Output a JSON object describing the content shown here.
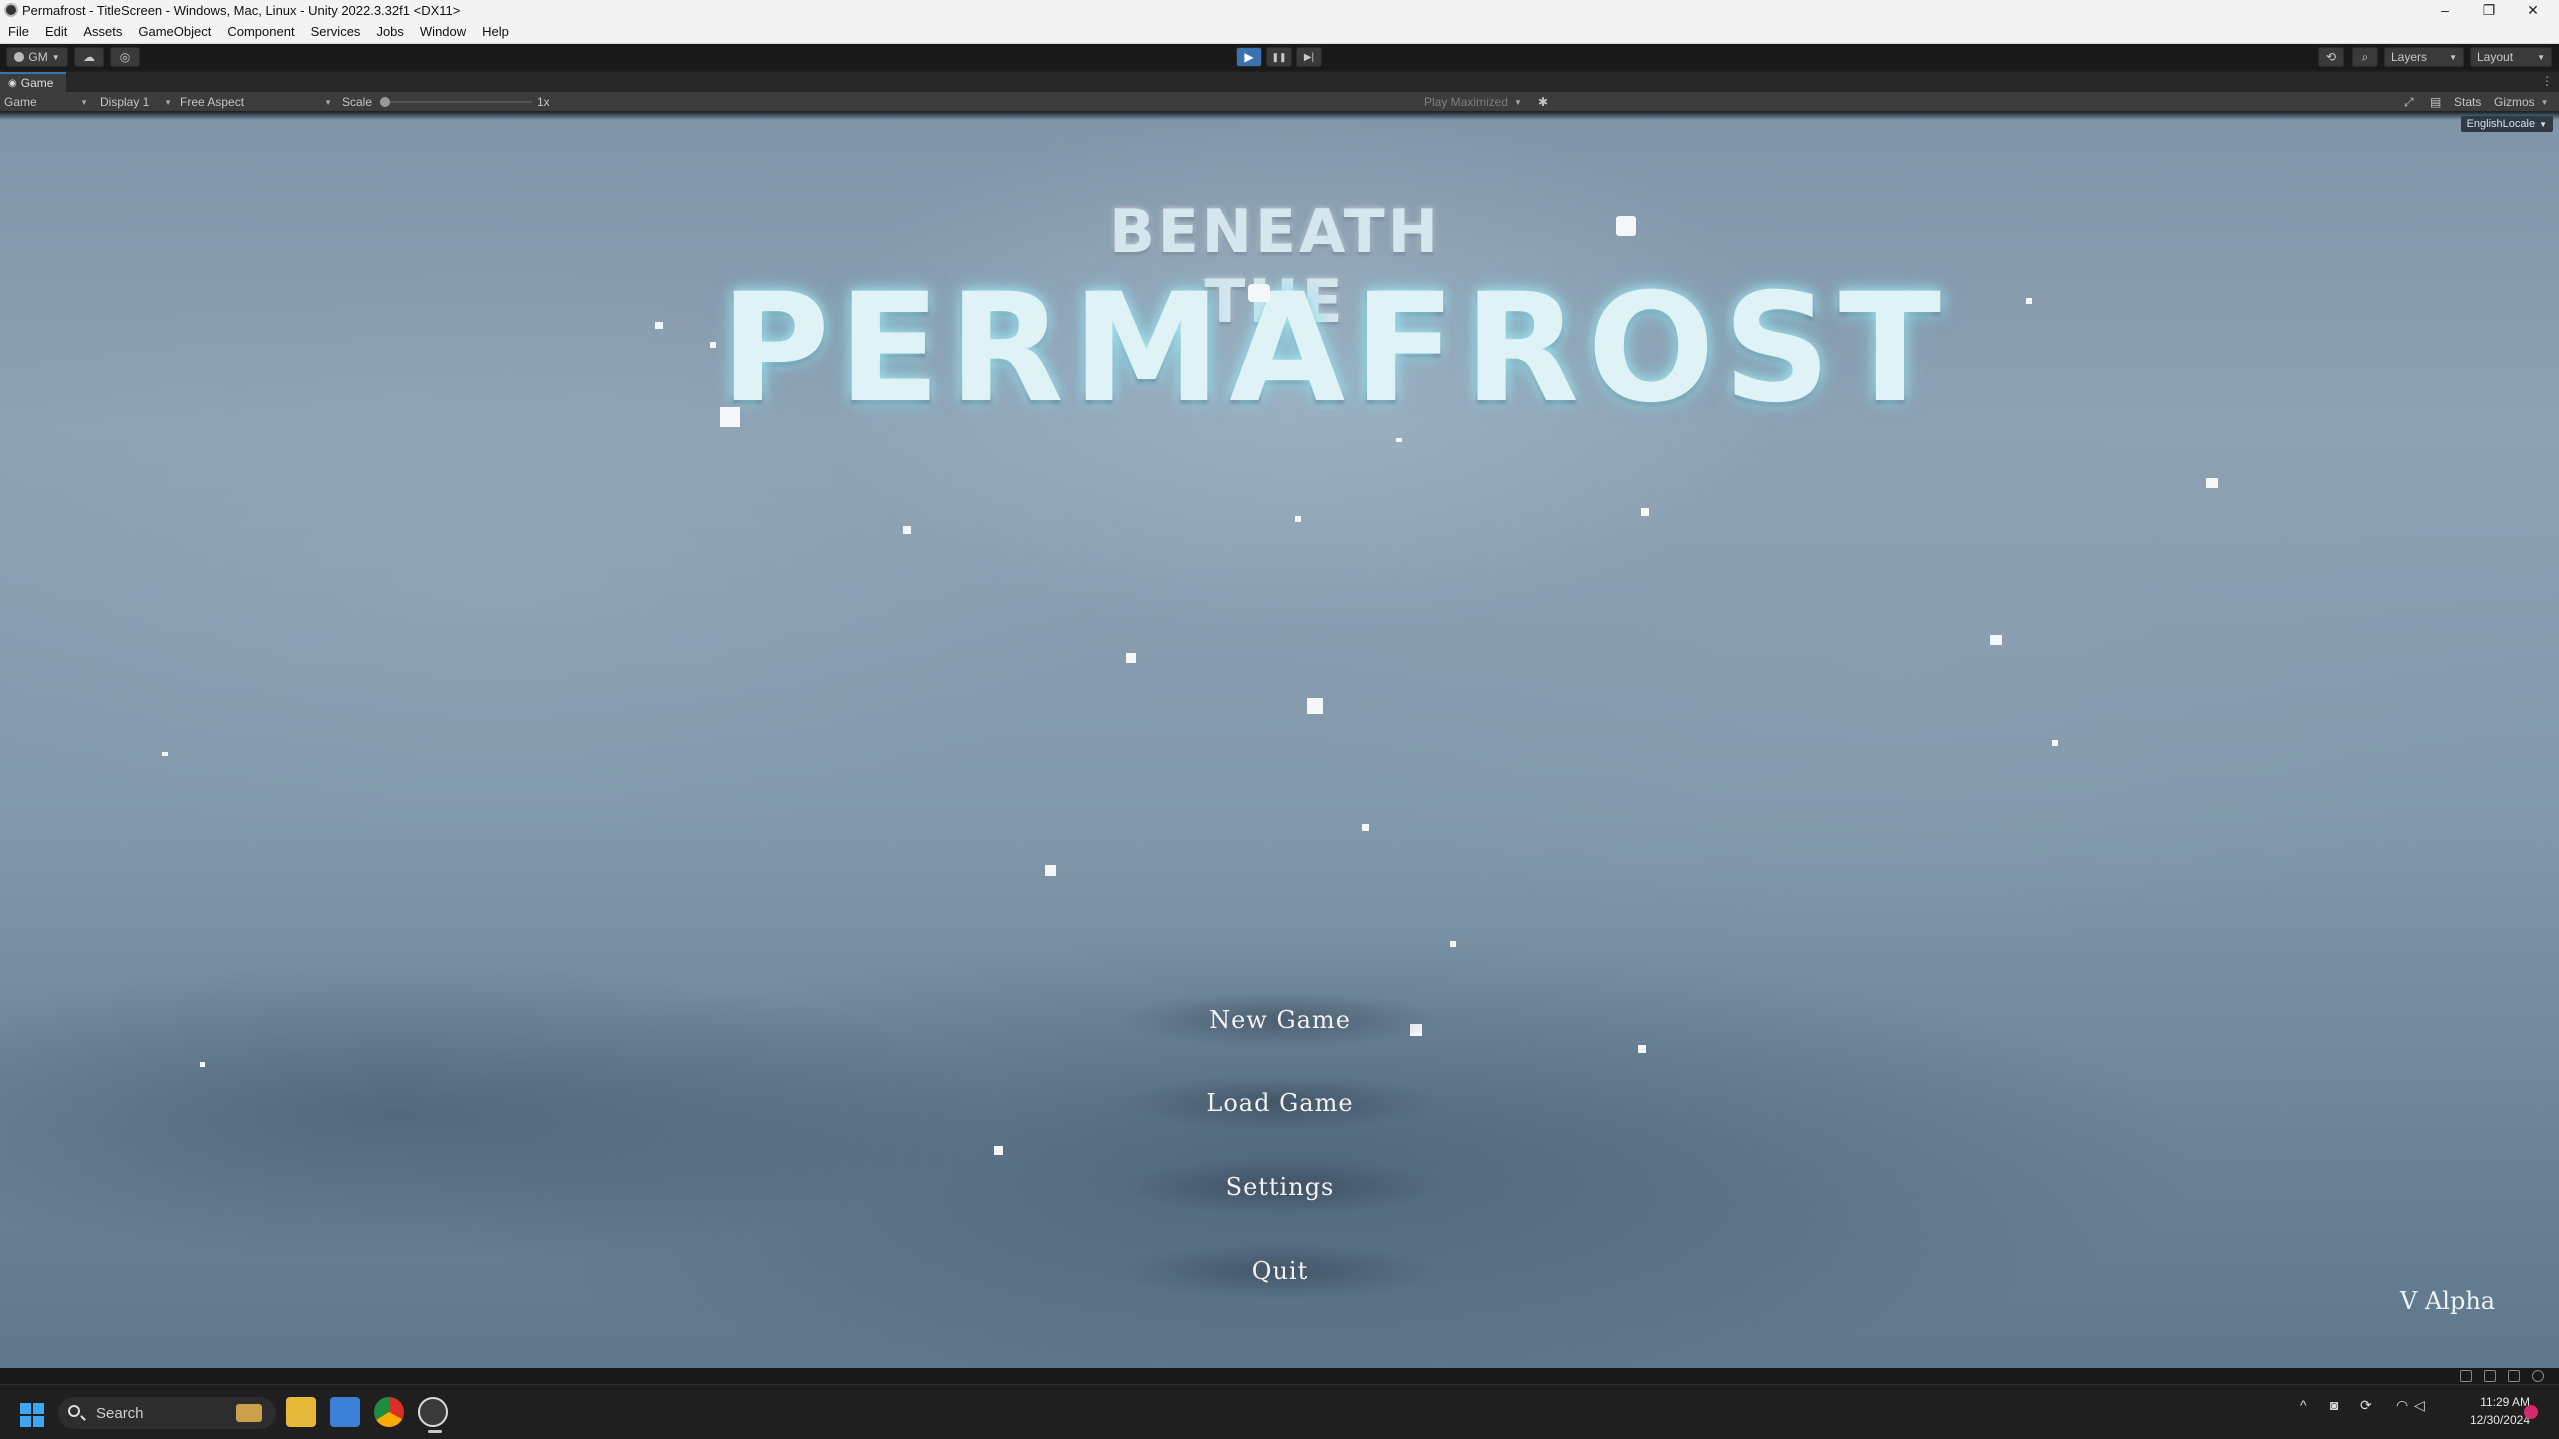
{
  "window": {
    "title": "Permafrost - TitleScreen - Windows, Mac, Linux - Unity 2022.3.32f1 <DX11>",
    "controls": {
      "minimize": "–",
      "restore": "❐",
      "close": "✕"
    }
  },
  "menubar": [
    "File",
    "Edit",
    "Assets",
    "GameObject",
    "Component",
    "Services",
    "Jobs",
    "Window",
    "Help"
  ],
  "toolbar": {
    "account": "GM",
    "play": "▶",
    "pause": "❚❚",
    "step": "▶|",
    "layers": "Layers",
    "layout": "Layout",
    "play_active": true
  },
  "game_tab": {
    "label": "Game"
  },
  "game_toolbar": {
    "view": "Game",
    "display": "Display 1",
    "aspect": "Free Aspect",
    "scale_label": "Scale",
    "scale_value": "1x",
    "play_mode": "Play Maximized",
    "stats": "Stats",
    "gizmos": "Gizmos"
  },
  "viewport": {
    "locale": "EnglishLocale",
    "title_top": "BENEATH THE",
    "title_main": "PERMAFROST",
    "menu": [
      "New Game",
      "Load Game",
      "Settings",
      "Quit"
    ],
    "version": "V Alpha"
  },
  "taskbar": {
    "search_placeholder": "Search",
    "time": "11:29 AM",
    "date": "12/30/2024"
  }
}
